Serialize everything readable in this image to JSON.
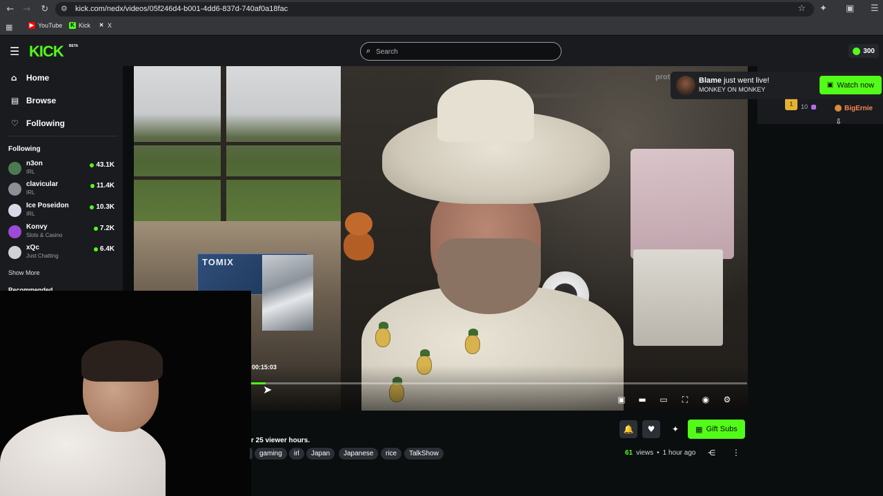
{
  "browser": {
    "url": "kick.com/nedx/videos/05f246d4-b001-4dd6-837d-740af0a18fac",
    "bookmarks": [
      {
        "label": "YouTube",
        "color": "#ff0000"
      },
      {
        "label": "Kick",
        "color": "#53fc18"
      },
      {
        "label": "X",
        "color": "#ffffff"
      }
    ]
  },
  "header": {
    "logo": "KICK",
    "logo_tag": "BETA",
    "search_placeholder": "Search",
    "points": "300"
  },
  "sidebar": {
    "nav": [
      {
        "label": "Home",
        "icon": "home-icon"
      },
      {
        "label": "Browse",
        "icon": "browse-icon"
      },
      {
        "label": "Following",
        "icon": "heart-icon"
      }
    ],
    "following_title": "Following",
    "channels": [
      {
        "name": "n3on",
        "category": "IRL",
        "viewers": "43.1K",
        "avatar_color": "#4e7a52"
      },
      {
        "name": "clavicular",
        "category": "IRL",
        "viewers": "11.4K",
        "avatar_color": "#8b8f96"
      },
      {
        "name": "Ice Poseidon",
        "category": "IRL",
        "viewers": "10.3K",
        "avatar_color": "#d7dbe8"
      },
      {
        "name": "Konvy",
        "category": "Slots & Casino",
        "viewers": "7.2K",
        "avatar_color": "#9c4bd6"
      },
      {
        "name": "xQc",
        "category": "Just Chatting",
        "viewers": "6.4K",
        "avatar_color": "#cfd3d6"
      }
    ],
    "show_more": "Show More",
    "recommended_title": "Recommended"
  },
  "player": {
    "timestamp": "00:15:03",
    "progress": 0.03,
    "watermark": "prot",
    "box_label": "TOMIX",
    "controls": [
      {
        "name": "mini-player-icon",
        "glyph": "▣"
      },
      {
        "name": "theater-mode-icon",
        "glyph": "▬"
      },
      {
        "name": "wide-mode-icon",
        "glyph": "▭"
      },
      {
        "name": "fullscreen-icon",
        "glyph": "⛶"
      },
      {
        "name": "playback-speed-icon",
        "glyph": "◉"
      },
      {
        "name": "settings-icon",
        "glyph": "⚙"
      }
    ]
  },
  "notification": {
    "streamer": "Blame",
    "message": "just went live!",
    "subtitle": "MONKEY ON MONKEY",
    "button": "Watch now"
  },
  "leaderboard": {
    "rank": "1",
    "count": "10",
    "name": "BigErnie"
  },
  "video_info": {
    "viewer_hours": "r 25 viewer hours.",
    "tags": [
      "gaming",
      "irl",
      "Japan",
      "Japanese",
      "rice",
      "TalkShow"
    ],
    "views": "61",
    "views_label": "views",
    "separator": "•",
    "age": "1 hour ago",
    "gift_button": "Gift Subs"
  }
}
